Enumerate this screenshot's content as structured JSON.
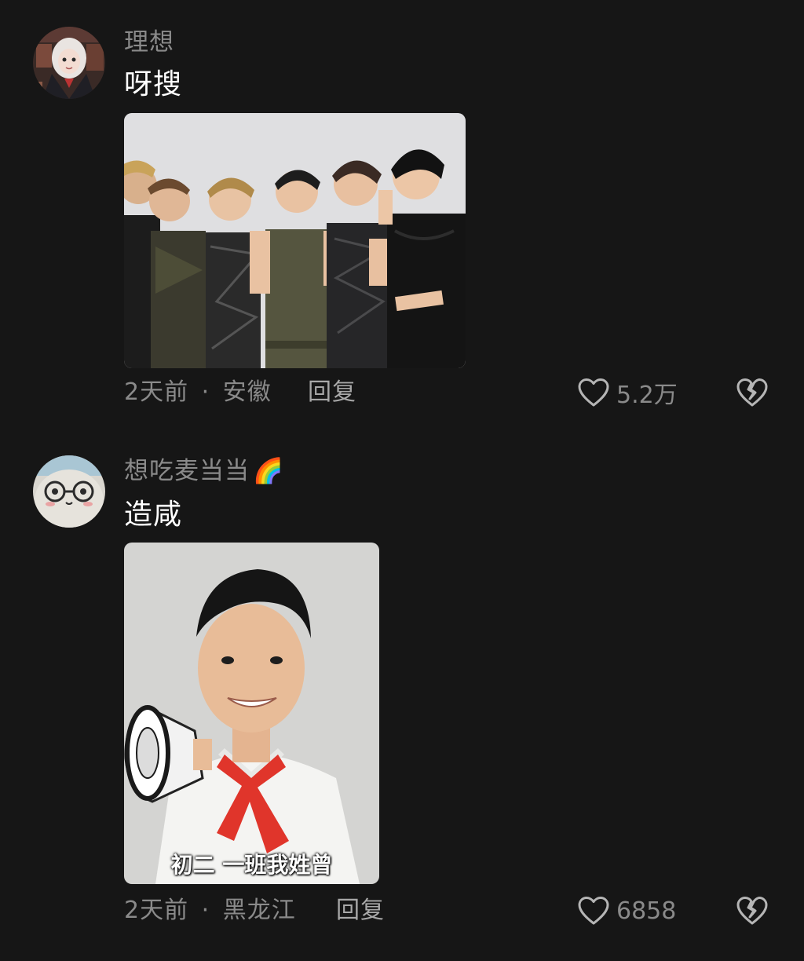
{
  "comments": [
    {
      "username": "理想",
      "text": "呀搜",
      "time": "2天前",
      "location": "安徽",
      "separator": "·",
      "reply_label": "回复",
      "like_count": "5.2万",
      "image": {
        "description_icon": "group-photo",
        "caption": ""
      }
    },
    {
      "username": "想吃麦当当",
      "username_emoji": "🌈",
      "text": "造咸",
      "time": "2天前",
      "location": "黑龙江",
      "separator": "·",
      "reply_label": "回复",
      "like_count": "6858",
      "image": {
        "description_icon": "megaphone-photo",
        "caption": "初二 一班我姓曾"
      }
    }
  ],
  "icons": {
    "like": "heart-outline-icon",
    "dislike": "broken-heart-icon"
  },
  "colors": {
    "background": "#161616",
    "primary_text": "#ffffff",
    "secondary_text": "#8a8a8a",
    "icon": "#b5b5b5"
  }
}
